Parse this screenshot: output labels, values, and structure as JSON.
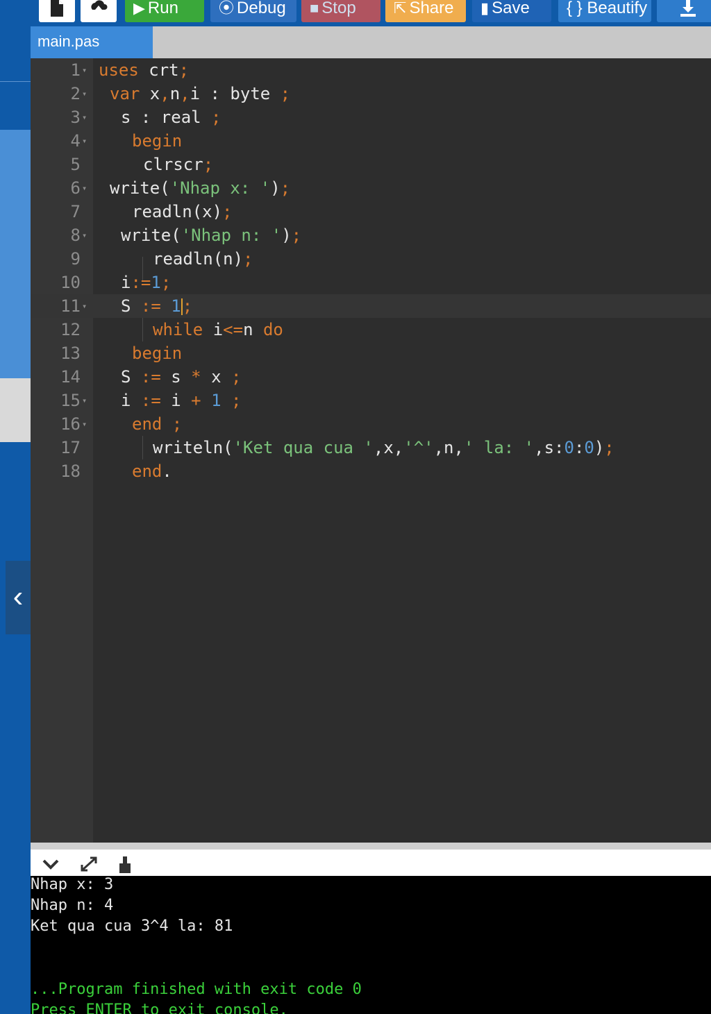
{
  "toolbar": {
    "new_icon": "file-icon",
    "upload_icon": "upload-icon",
    "run_label": "Run",
    "debug_label": "Debug",
    "stop_label": "Stop",
    "share_label": "Share",
    "save_label": "Save",
    "beautify_label": "{ } Beautify",
    "download_icon": "download-icon"
  },
  "file_tab": {
    "label": "main.pas"
  },
  "editor": {
    "active_line": 11,
    "lines": [
      {
        "n": "1",
        "fold": true
      },
      {
        "n": "2",
        "fold": true
      },
      {
        "n": "3",
        "fold": true
      },
      {
        "n": "4",
        "fold": true
      },
      {
        "n": "5",
        "fold": false
      },
      {
        "n": "6",
        "fold": true
      },
      {
        "n": "7",
        "fold": false
      },
      {
        "n": "8",
        "fold": true
      },
      {
        "n": "9",
        "fold": false
      },
      {
        "n": "10",
        "fold": false
      },
      {
        "n": "11",
        "fold": true
      },
      {
        "n": "12",
        "fold": false
      },
      {
        "n": "13",
        "fold": false
      },
      {
        "n": "14",
        "fold": false
      },
      {
        "n": "15",
        "fold": true
      },
      {
        "n": "16",
        "fold": true
      },
      {
        "n": "17",
        "fold": false
      },
      {
        "n": "18",
        "fold": false
      }
    ],
    "code": {
      "l1": [
        "uses",
        " crt",
        ";"
      ],
      "l2": [
        "var",
        " x",
        ",",
        "n",
        ",",
        "i",
        " : byte ",
        ";"
      ],
      "l3": [
        "s : real ",
        ";"
      ],
      "l4": [
        "begin"
      ],
      "l5": [
        "clrscr",
        ";"
      ],
      "l6": [
        "write(",
        "'Nhap x: '",
        ")",
        ";"
      ],
      "l7": [
        "readln(x)",
        ";"
      ],
      "l8": [
        "write(",
        "'Nhap n: '",
        ")",
        ";"
      ],
      "l9": [
        "readln(n)",
        ";"
      ],
      "l10": [
        "i",
        ":=",
        "1",
        ";"
      ],
      "l11": [
        "S ",
        ":=",
        " 1",
        ";"
      ],
      "l12": [
        "while",
        " i",
        "<=",
        "n ",
        "do"
      ],
      "l13": [
        "begin"
      ],
      "l14": [
        "S ",
        ":=",
        " s ",
        "*",
        " x ",
        ";"
      ],
      "l15": [
        "i ",
        ":=",
        " i ",
        "+",
        " 1",
        " ;"
      ],
      "l16": [
        "end",
        " ;"
      ],
      "l17": [
        "writeln(",
        "'Ket qua cua '",
        ",x,",
        "'^'",
        ",n,",
        "' la: '",
        ",s:",
        "0",
        ":",
        "0",
        ")",
        ";"
      ],
      "l18": [
        "end",
        "."
      ]
    }
  },
  "console_bar": {
    "collapse_icon": "chevron-down-icon",
    "expand_icon": "expand-icon",
    "clear_icon": "clear-console-icon"
  },
  "console": {
    "lines": [
      "Nhap x: 3",
      "Nhap n: 4",
      "Ket qua cua 3^4 la: 81",
      "",
      "...Program finished with exit code 0",
      "Press ENTER to exit console."
    ]
  },
  "colors": {
    "keyword": "#d97b2f",
    "string": "#7bc27b",
    "number": "#5b9bd5",
    "run": "#3aa83a",
    "stop": "#d9534f",
    "share": "#f0ad4e",
    "console_success": "#3bd13b"
  }
}
